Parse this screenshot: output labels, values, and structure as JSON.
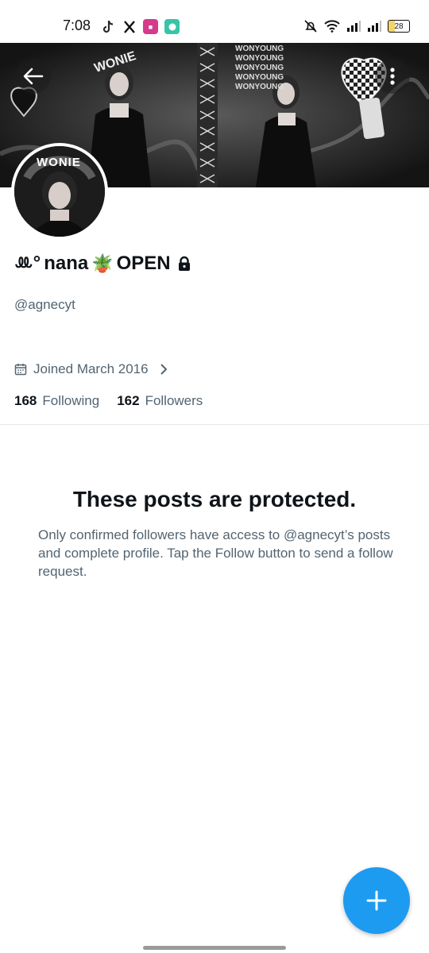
{
  "status_bar": {
    "time": "7:08",
    "battery": "28",
    "notification_icons": [
      "tiktok-icon",
      "x-icon",
      "app-icon",
      "chat-bubble-icon"
    ]
  },
  "banner": {
    "labels": [
      "WONIE",
      "WONYOUNG"
    ]
  },
  "avatar": {
    "label": "WONIE"
  },
  "profile": {
    "name_prefix": "ꔛ°",
    "name_main": "nana",
    "plant_emoji": "🪴",
    "name_suffix": "OPEN",
    "handle": "@agnecyt",
    "joined": "Joined March 2016",
    "following_count": "168",
    "following_label": "Following",
    "followers_count": "162",
    "followers_label": "Followers"
  },
  "protected": {
    "title": "These posts are protected.",
    "body": "Only confirmed followers have access to @agnecyt’s posts and complete profile. Tap the Follow button to send a follow request."
  },
  "colors": {
    "accent": "#1d9bf0",
    "text_primary": "#0f1419",
    "text_secondary": "#536471"
  }
}
